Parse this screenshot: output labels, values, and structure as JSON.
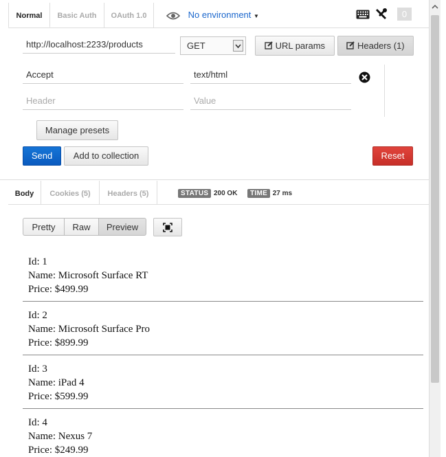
{
  "top_tabs": [
    {
      "label": "Normal",
      "active": true
    },
    {
      "label": "Basic Auth",
      "active": false
    },
    {
      "label": "OAuth 1.0",
      "active": false
    }
  ],
  "environment": {
    "label": "No environment"
  },
  "toolbar": {
    "counter": "0"
  },
  "request": {
    "url": "http://localhost:2233/products",
    "method": "GET",
    "url_params_label": "URL params",
    "headers_label": "Headers (1)"
  },
  "headers": {
    "rows": [
      {
        "key": "Accept",
        "value": "text/html"
      }
    ],
    "new_key_placeholder": "Header",
    "new_value_placeholder": "Value",
    "manage_presets_label": "Manage presets"
  },
  "actions": {
    "send_label": "Send",
    "add_to_collection_label": "Add to collection",
    "reset_label": "Reset"
  },
  "response_tabs": [
    {
      "label": "Body",
      "active": true
    },
    {
      "label": "Cookies (5)",
      "active": false
    },
    {
      "label": "Headers (5)",
      "active": false
    }
  ],
  "status": {
    "badge": "STATUS",
    "value": "200 OK"
  },
  "time": {
    "badge": "TIME",
    "value": "27 ms"
  },
  "view_modes": [
    {
      "label": "Pretty",
      "active": false
    },
    {
      "label": "Raw",
      "active": false
    },
    {
      "label": "Preview",
      "active": true
    }
  ],
  "products": [
    {
      "id": "Id: 1",
      "name": "Name: Microsoft Surface RT",
      "price": "Price: $499.99"
    },
    {
      "id": "Id: 2",
      "name": "Name: Microsoft Surface Pro",
      "price": "Price: $899.99"
    },
    {
      "id": "Id: 3",
      "name": "Name: iPad 4",
      "price": "Price: $599.99"
    },
    {
      "id": "Id: 4",
      "name": "Name: Nexus 7",
      "price": "Price: $249.99"
    }
  ],
  "colors": {
    "accent_blue": "#1a66cc",
    "send_blue": "#0a5bbf",
    "reset_red": "#d0382f",
    "badge_gray": "#777777"
  }
}
